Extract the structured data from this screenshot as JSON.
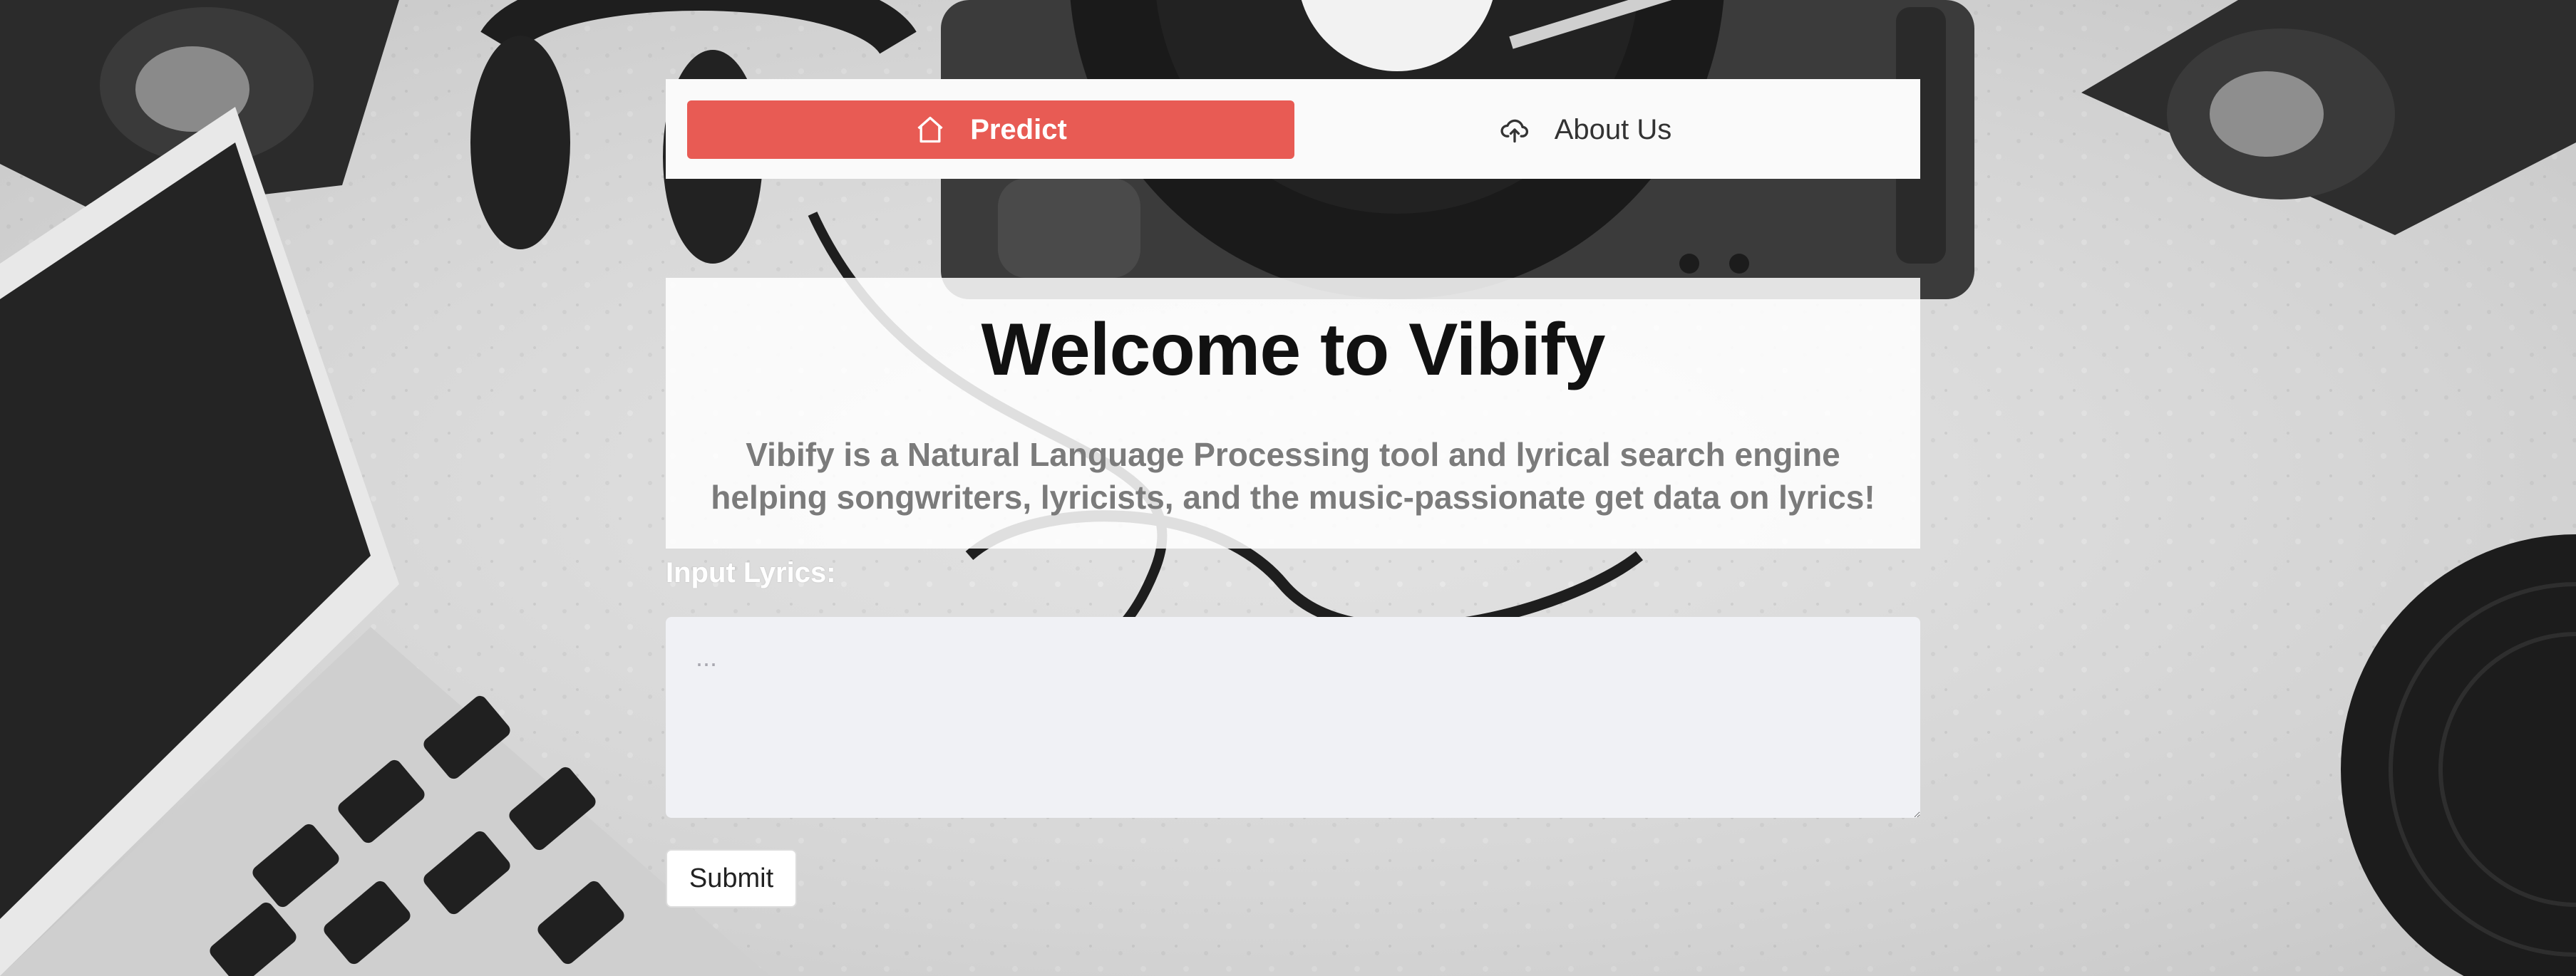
{
  "nav": {
    "predict_label": "Predict",
    "predict_icon": "home-icon",
    "about_label": "About Us",
    "about_icon": "cloud-upload-icon"
  },
  "hero": {
    "title": "Welcome to Vibify",
    "subtitle": "Vibify is a Natural Language Processing tool and lyrical search engine helping songwriters, lyricists, and the music-passionate get data on lyrics!"
  },
  "form": {
    "lyrics_label": "Input Lyrics:",
    "lyrics_placeholder": "...",
    "lyrics_value": "",
    "submit_label": "Submit"
  },
  "colors": {
    "accent": "#e85b54",
    "nav_bg": "#fafafa",
    "input_bg": "#f0f1f5"
  }
}
